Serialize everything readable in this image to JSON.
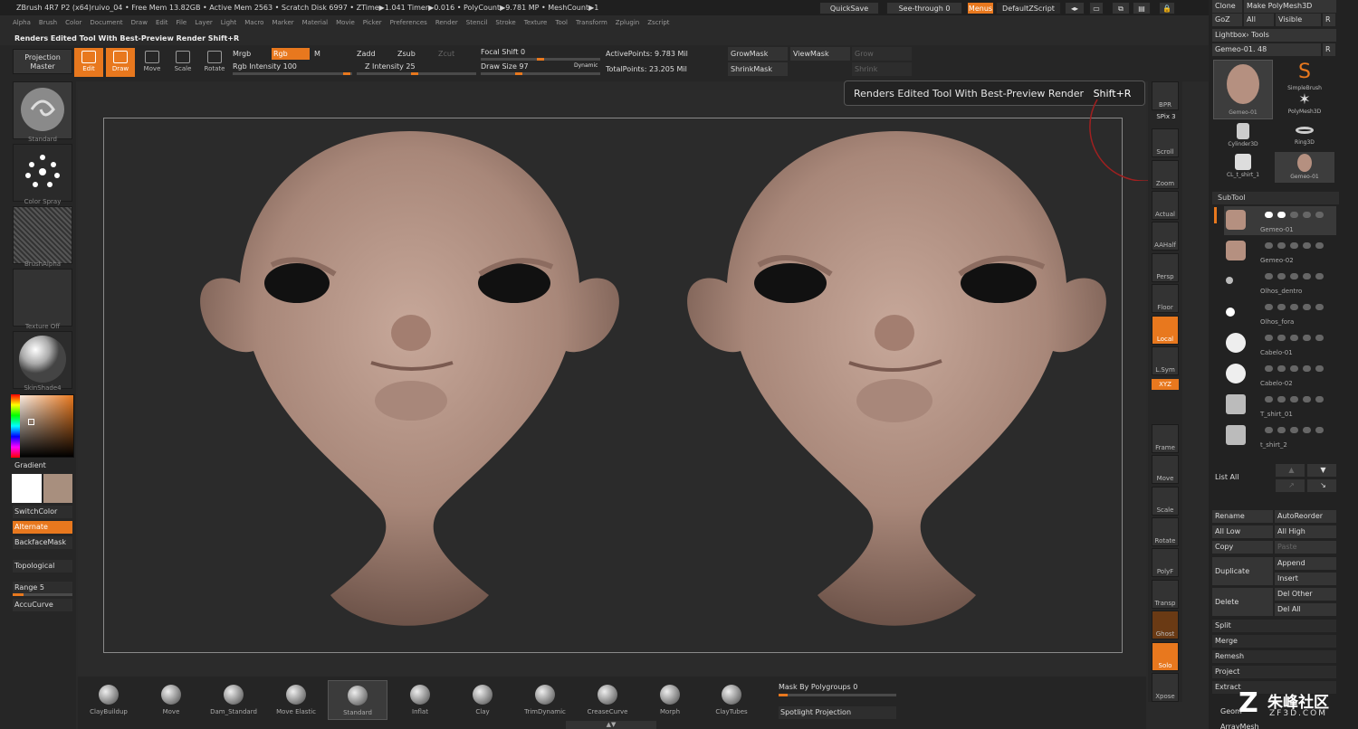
{
  "title_bar": {
    "text": "ZBrush 4R7 P2 (x64)ruivo_04  • Free Mem 13.82GB • Active Mem 2563 • Scratch Disk 6997 • ZTime▶1.041 Timer▶0.016 • PolyCount▶9.781 MP • MeshCount▶1",
    "quicksave": "QuickSave",
    "see_through": "See-through  0",
    "menus": "Menus",
    "zscript": "DefaultZScript"
  },
  "menu": [
    "Alpha",
    "Brush",
    "Color",
    "Document",
    "Draw",
    "Edit",
    "File",
    "Layer",
    "Light",
    "Macro",
    "Marker",
    "Material",
    "Movie",
    "Picker",
    "Preferences",
    "Render",
    "Stencil",
    "Stroke",
    "Texture",
    "Tool",
    "Transform",
    "Zplugin",
    "Zscript"
  ],
  "status_tip": "Renders Edited Tool With Best-Preview Render  Shift+R",
  "toolbar": {
    "projection_master": "Projection\nMaster",
    "edit": "Edit",
    "draw": "Draw",
    "move": "Move",
    "scale": "Scale",
    "rotate": "Rotate",
    "mrgb": "Mrgb",
    "rgb": "Rgb",
    "m": "M",
    "rgb_intensity": "Rgb Intensity 100",
    "zadd": "Zadd",
    "zsub": "Zsub",
    "zcut": "Zcut",
    "z_intensity": "Z Intensity 25",
    "focal_shift": "Focal Shift 0",
    "draw_size": "Draw Size 97",
    "dynamic": "Dynamic",
    "active_points": "ActivePoints: 9.783 Mil",
    "total_points": "TotalPoints: 23.205 Mil",
    "growmask": "GrowMask",
    "viewmask": "ViewMask",
    "grow": "Grow",
    "shrinkmask": "ShrinkMask",
    "shrink": "Shrink"
  },
  "left_panel": {
    "thumbs": [
      "Standard",
      "Color Spray",
      "BrushAlpha",
      "Texture Off",
      "SkinShade4"
    ],
    "gradient": "Gradient",
    "switch_color": "SwitchColor",
    "alternate": "Alternate",
    "backface": "BackfaceMask",
    "topological": "Topological",
    "range": "Range 5",
    "accucurve": "AccuCurve"
  },
  "tooltip": {
    "text": "Renders Edited Tool With Best-Preview Render",
    "shortcut": "Shift+R"
  },
  "right_shelf": [
    "BPR",
    "SPix 3",
    "Scroll",
    "Zoom",
    "Actual",
    "AAHalf",
    "Persp",
    "Floor",
    "Local",
    "L.Sym",
    "Frame",
    "Move",
    "Scale",
    "Rotate",
    "PolyF",
    "Transp",
    "Ghost",
    "Solo",
    "Xpose"
  ],
  "right_panel": {
    "clone": "Clone",
    "make_polymesh": "Make PolyMesh3D",
    "goz": "GoZ",
    "all": "All",
    "visible": "Visible",
    "r": "R",
    "lightbox_tools": "Lightbox› Tools",
    "tool_name": "Gemeo-01. 48",
    "tools": [
      "Gemeo-01",
      "SimpleBrush",
      "PolyMesh3D",
      "Cylinder3D",
      "Ring3D",
      "CL_t_shirt_1",
      "Gemeo-01"
    ],
    "subtool": "SubTool",
    "subtools": [
      "Gemeo-01",
      "Gemeo-02",
      "Olhos_dentro",
      "Olhos_fora",
      "Cabelo-01",
      "Cabelo-02",
      "T_shirt_01",
      "t_shirt_2"
    ],
    "list_all": "List All",
    "rename": "Rename",
    "autoreorder": "AutoReorder",
    "all_low": "All Low",
    "all_high": "All High",
    "copy": "Copy",
    "paste": "Paste",
    "duplicate": "Duplicate",
    "append": "Append",
    "insert": "Insert",
    "delete": "Delete",
    "del_other": "Del Other",
    "del_all": "Del All",
    "split": "Split",
    "merge": "Merge",
    "remesh": "Remesh",
    "project": "Project",
    "extract": "Extract",
    "geom": "Geom",
    "arraymesh": "ArrayMesh"
  },
  "bottom_shelf": {
    "brushes": [
      "ClayBuildup",
      "Move",
      "Dam_Standard",
      "Move Elastic",
      "Standard",
      "Inflat",
      "Clay",
      "TrimDynamic",
      "CreaseCurve",
      "Morph",
      "ClayTubes"
    ],
    "mask_by_polygroups": "Mask By Polygroups 0",
    "spotlight_projection": "Spotlight Projection"
  },
  "watermark": {
    "text": "朱峰社区",
    "sub": "ZF3D.COM"
  }
}
